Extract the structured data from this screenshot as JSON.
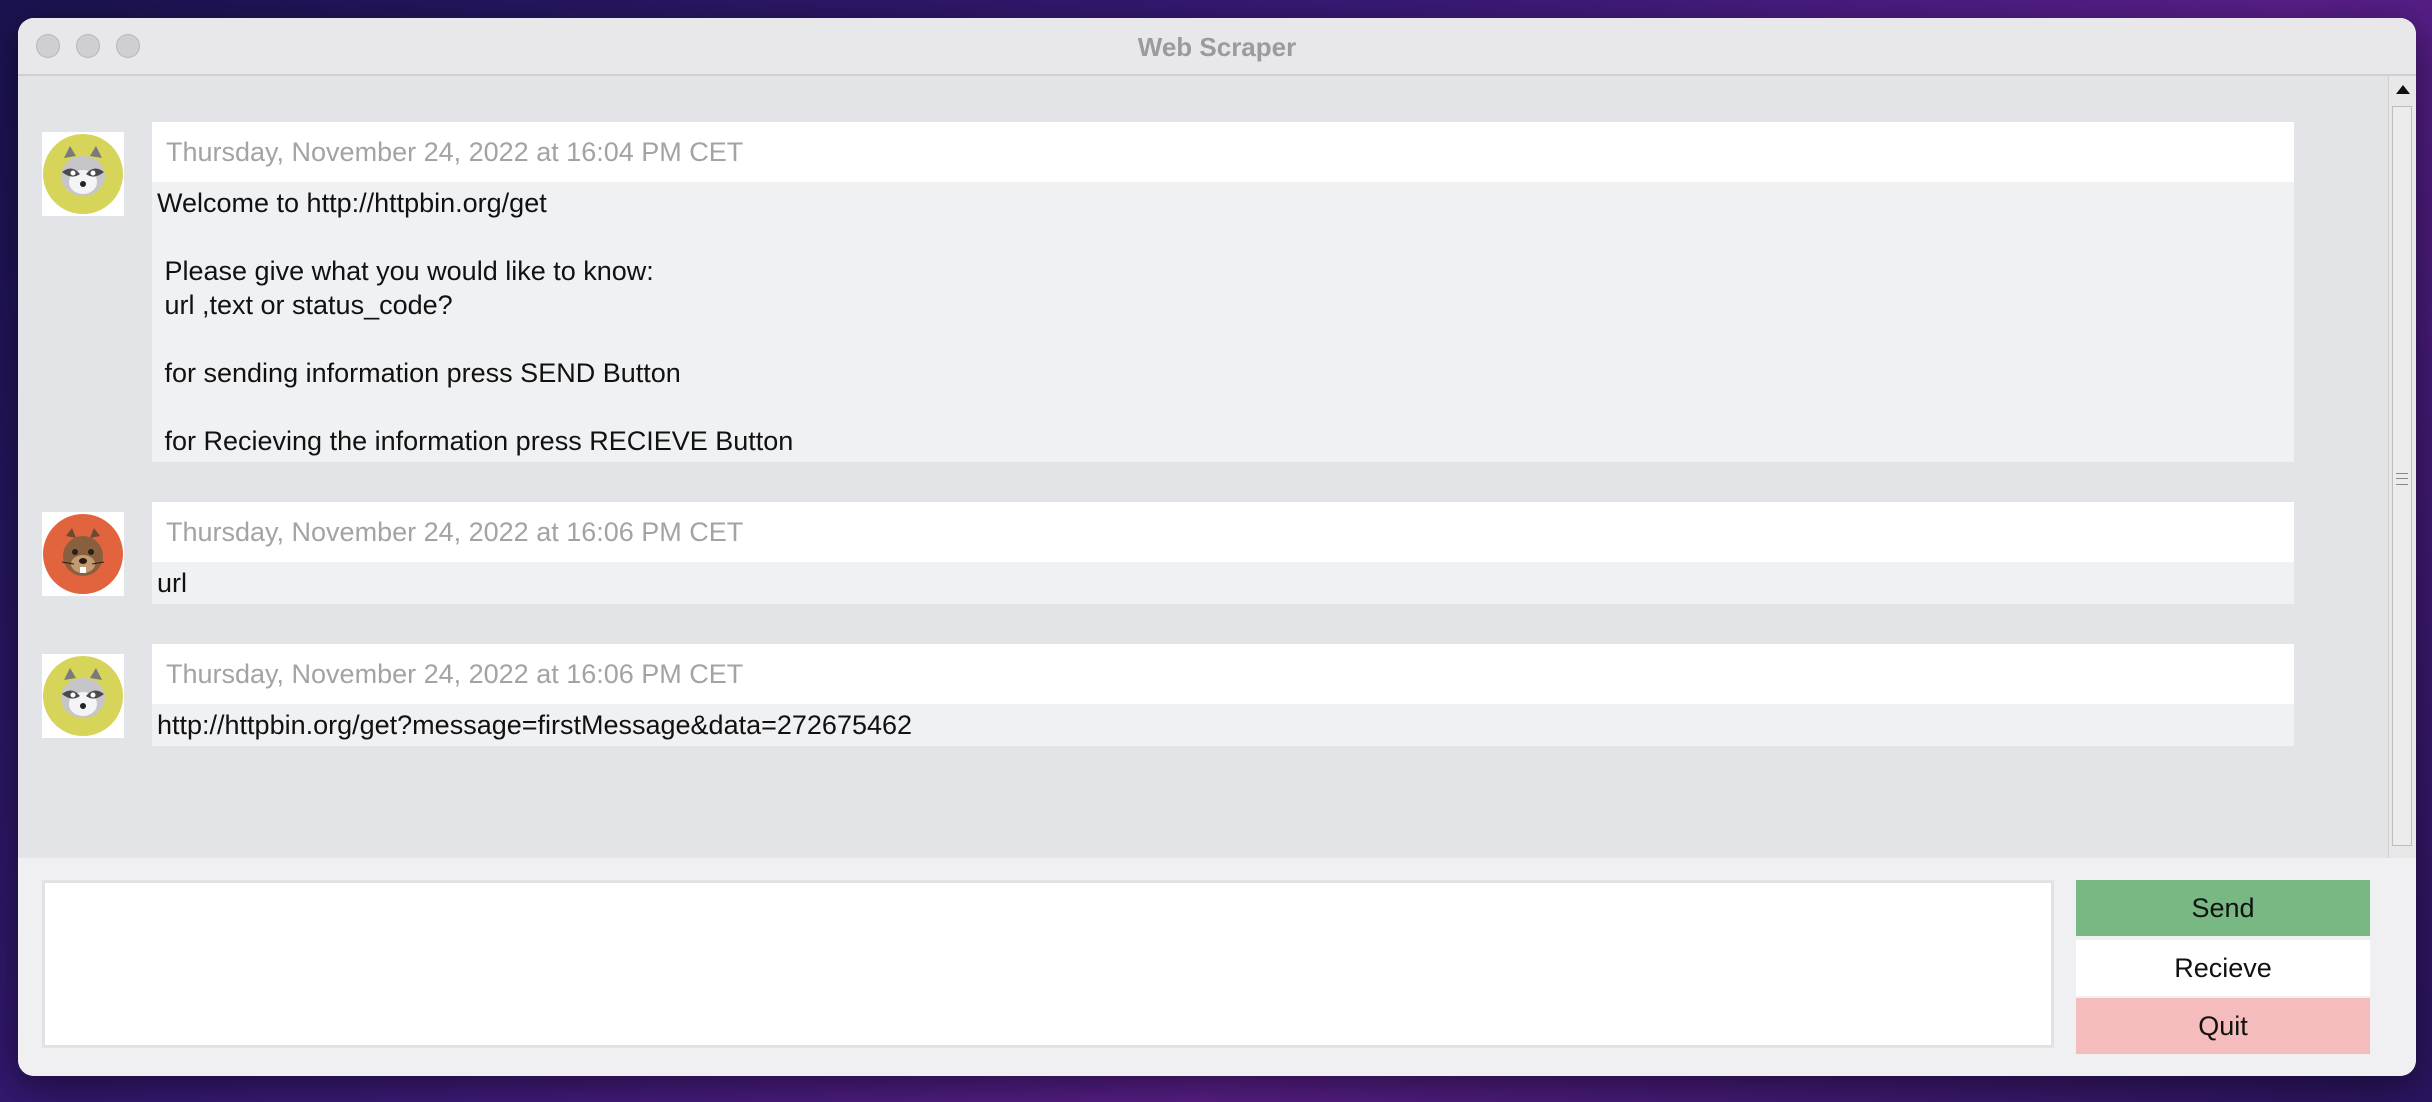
{
  "window": {
    "title": "Web Scraper"
  },
  "messages": [
    {
      "sender": "bot",
      "avatar": "raccoon-icon",
      "timestamp": "Thursday, November 24, 2022 at 16:04 PM CET",
      "text": "Welcome to http://httpbin.org/get\n\n Please give what you would like to know:\n url ,text or status_code?\n\n for sending information press SEND Button\n\n for Recieving the information press RECIEVE Button"
    },
    {
      "sender": "user",
      "avatar": "beaver-icon",
      "timestamp": "Thursday, November 24, 2022 at 16:06 PM CET",
      "text": "url"
    },
    {
      "sender": "bot",
      "avatar": "raccoon-icon",
      "timestamp": "Thursday, November 24, 2022 at 16:06 PM CET",
      "text": "http://httpbin.org/get?message=firstMessage&data=272675462"
    }
  ],
  "input": {
    "value": "",
    "placeholder": ""
  },
  "buttons": {
    "send": "Send",
    "recieve": "Recieve",
    "quit": "Quit"
  },
  "colors": {
    "send": "#77b883",
    "recieve": "#ffffff",
    "quit": "#f4bcbc",
    "raccoon_bg": "#d7d45a",
    "beaver_bg": "#e2643e"
  }
}
